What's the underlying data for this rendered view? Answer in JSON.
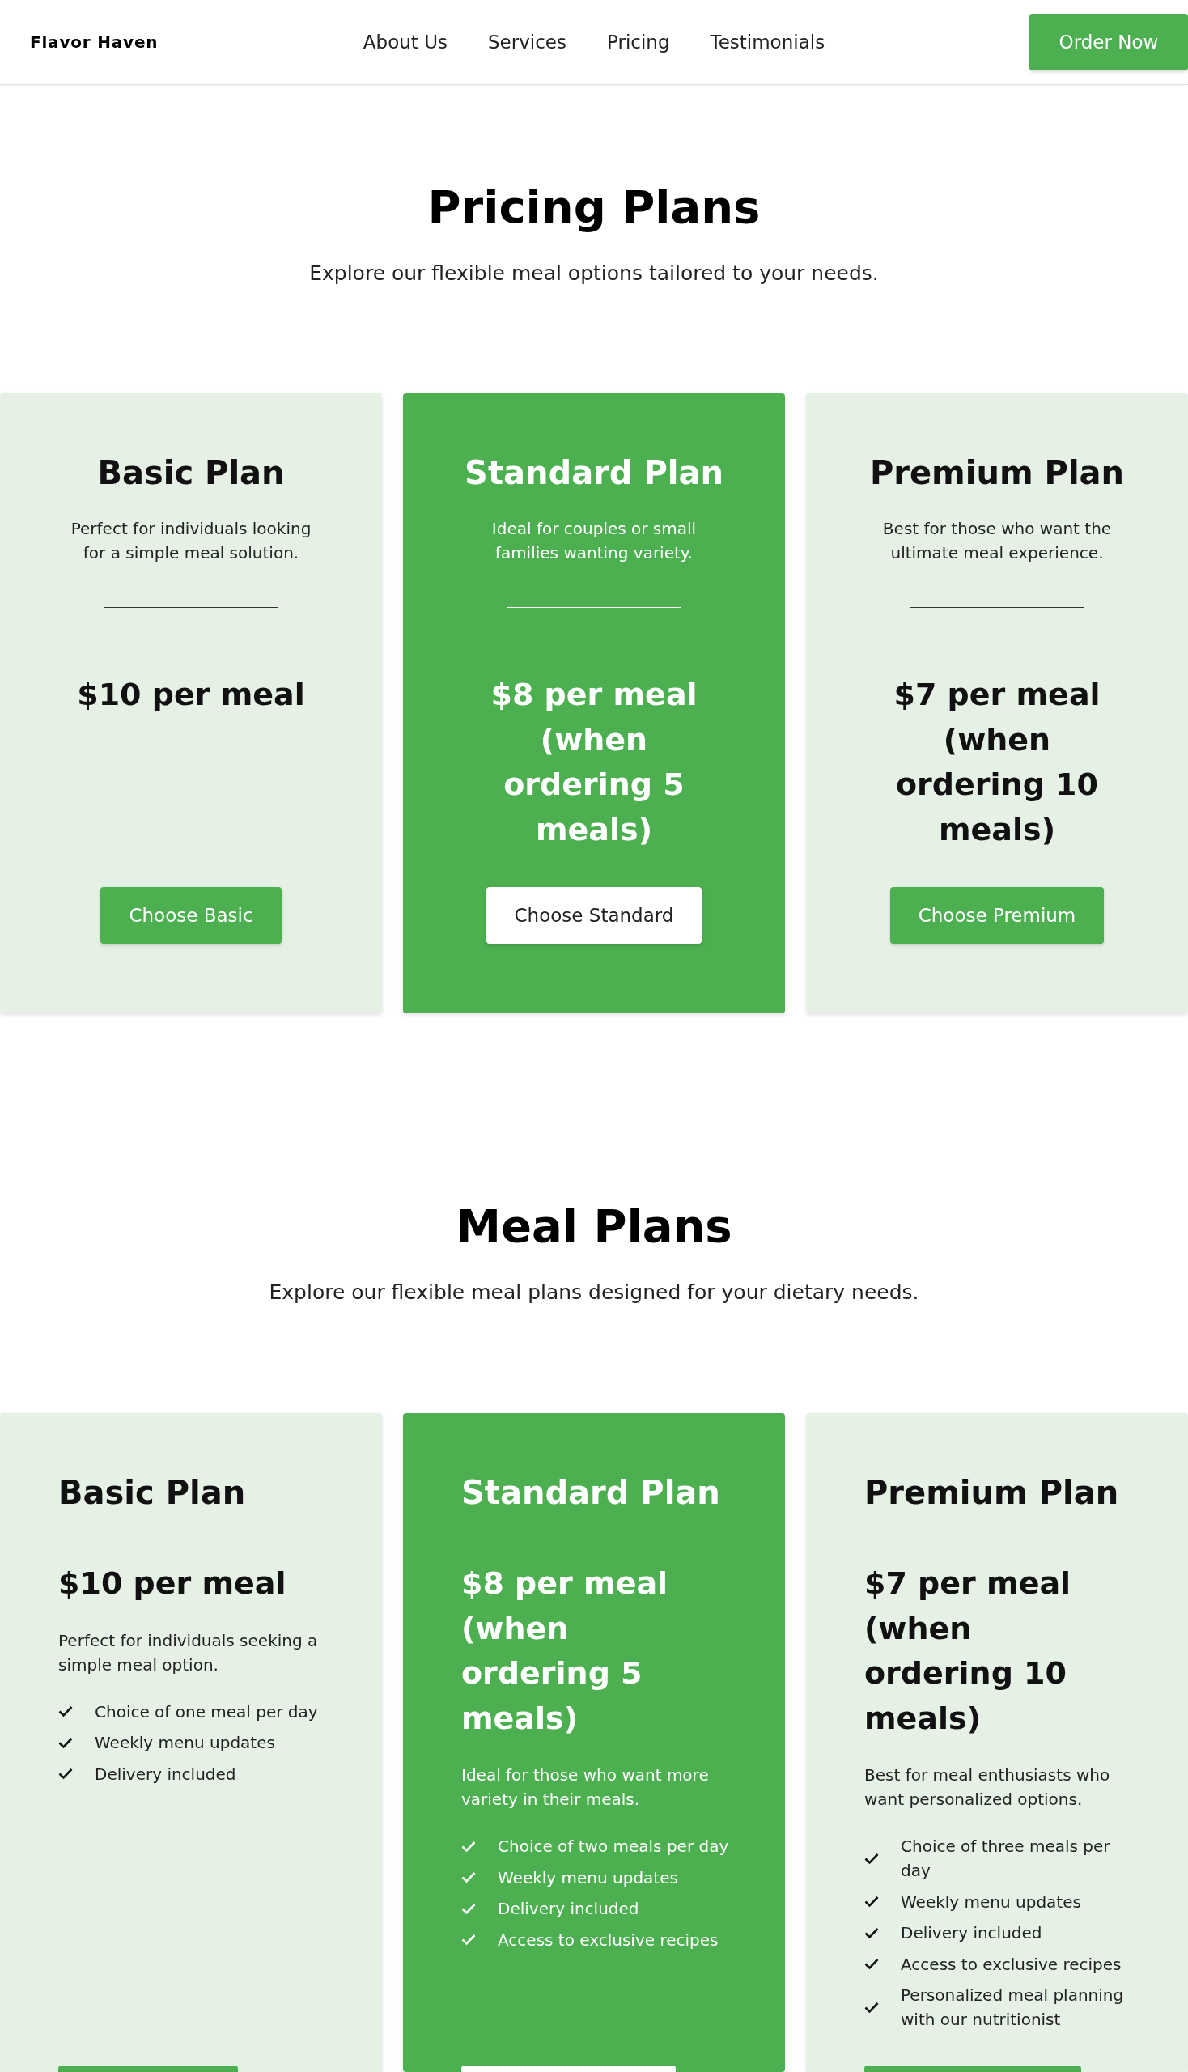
{
  "header": {
    "logo": "Flavor Haven",
    "nav": [
      "About Us",
      "Services",
      "Pricing",
      "Testimonials"
    ],
    "cta": "Order Now"
  },
  "pricing": {
    "title": "Pricing Plans",
    "subtitle": "Explore our flexible meal options tailored to your needs.",
    "plans": [
      {
        "name": "Basic Plan",
        "description": "Perfect for individuals looking for a simple meal solution.",
        "price": "$10 per meal",
        "button": "Choose Basic",
        "highlighted": false
      },
      {
        "name": "Standard Plan",
        "description": "Ideal for couples or small families wanting variety.",
        "price": "$8 per meal (when ordering 5 meals)",
        "button": "Choose Standard",
        "highlighted": true
      },
      {
        "name": "Premium Plan",
        "description": "Best for those who want the ultimate meal experience.",
        "price": "$7 per meal (when ordering 10 meals)",
        "button": "Choose Premium",
        "highlighted": false
      }
    ]
  },
  "meal_plans": {
    "title": "Meal Plans",
    "subtitle": "Explore our flexible meal plans designed for your dietary needs.",
    "plans": [
      {
        "name": "Basic Plan",
        "price": "$10 per meal",
        "description": "Perfect for individuals seeking a simple meal option.",
        "features": [
          "Choice of one meal per day",
          "Weekly menu updates",
          "Delivery included"
        ],
        "highlighted": false
      },
      {
        "name": "Standard Plan",
        "price": "$8 per meal (when ordering 5 meals)",
        "description": "Ideal for those who want more variety in their meals.",
        "features": [
          "Choice of two meals per day",
          "Weekly menu updates",
          "Delivery included",
          "Access to exclusive recipes"
        ],
        "highlighted": true
      },
      {
        "name": "Premium Plan",
        "price": "$7 per meal (when ordering 10 meals)",
        "description": "Best for meal enthusiasts who want personalized options.",
        "features": [
          "Choice of three meals per day",
          "Weekly menu updates",
          "Delivery included",
          "Access to exclusive recipes",
          "Personalized meal planning with our nutritionist"
        ],
        "highlighted": false
      }
    ]
  }
}
